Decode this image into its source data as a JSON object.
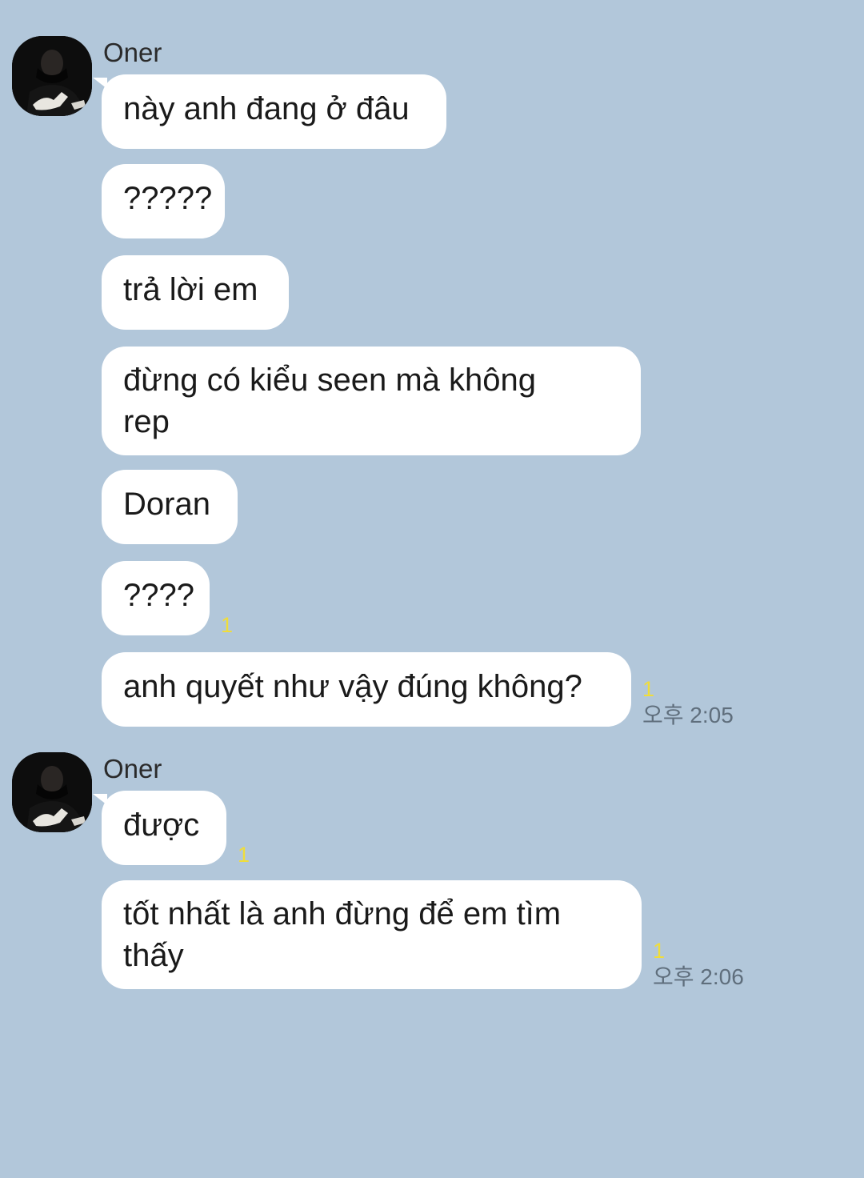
{
  "groups": [
    {
      "sender": "Oner",
      "messages": [
        {
          "text": "này anh đang ở đâu"
        },
        {
          "text": "?????"
        },
        {
          "text": "trả lời em"
        },
        {
          "lines": [
            "đừng có kiểu seen mà không",
            "rep"
          ]
        },
        {
          "text": "Doran"
        },
        {
          "text": "????",
          "unread": "1"
        },
        {
          "text": "anh quyết như vậy đúng không?",
          "unread": "1",
          "time": "오후 2:05"
        }
      ]
    },
    {
      "sender": "Oner",
      "messages": [
        {
          "text": "được",
          "unread": "1"
        },
        {
          "lines": [
            "tốt nhất là anh đừng để em tìm",
            "thấy"
          ],
          "unread": "1",
          "time": "오후 2:06"
        }
      ]
    }
  ],
  "icons": {
    "avatar": "profile-avatar-icon"
  },
  "colors": {
    "background": "#b2c7da",
    "bubble": "#ffffff",
    "unread_count": "#f0dd3a",
    "timestamp": "#5f6e7c"
  }
}
